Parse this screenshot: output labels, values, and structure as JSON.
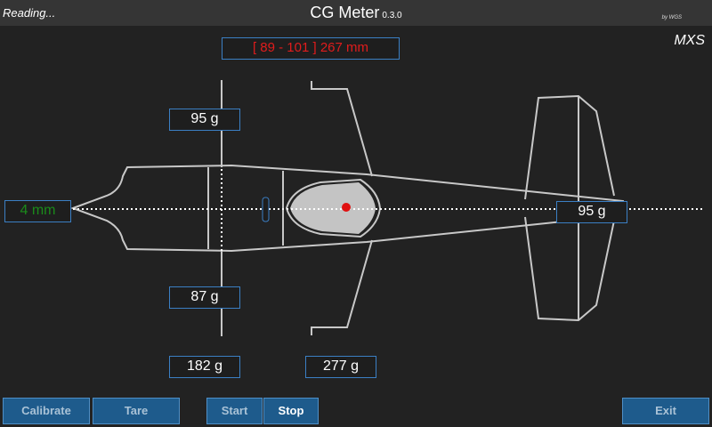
{
  "header": {
    "status": "Reading...",
    "title": "CG Meter",
    "version": "0.3.0",
    "byline": "by WGS",
    "model": "MXS"
  },
  "readouts": {
    "cg_range": "[ 89 - 101 ] 267 mm",
    "lateral_offset": "4 mm",
    "left_wing": "95 g",
    "right_wing": "87 g",
    "tail": "95 g",
    "main_total": "182 g",
    "total": "277 g"
  },
  "colors": {
    "accent": "#3b7fc4",
    "range_text": "#e01c1c",
    "offset_text": "#1a8a1a",
    "cg_marker": "#e01010",
    "button_bg": "#1e5b8c"
  },
  "buttons": {
    "calibrate": "Calibrate",
    "tare": "Tare",
    "start": "Start",
    "stop": "Stop",
    "exit": "Exit"
  }
}
